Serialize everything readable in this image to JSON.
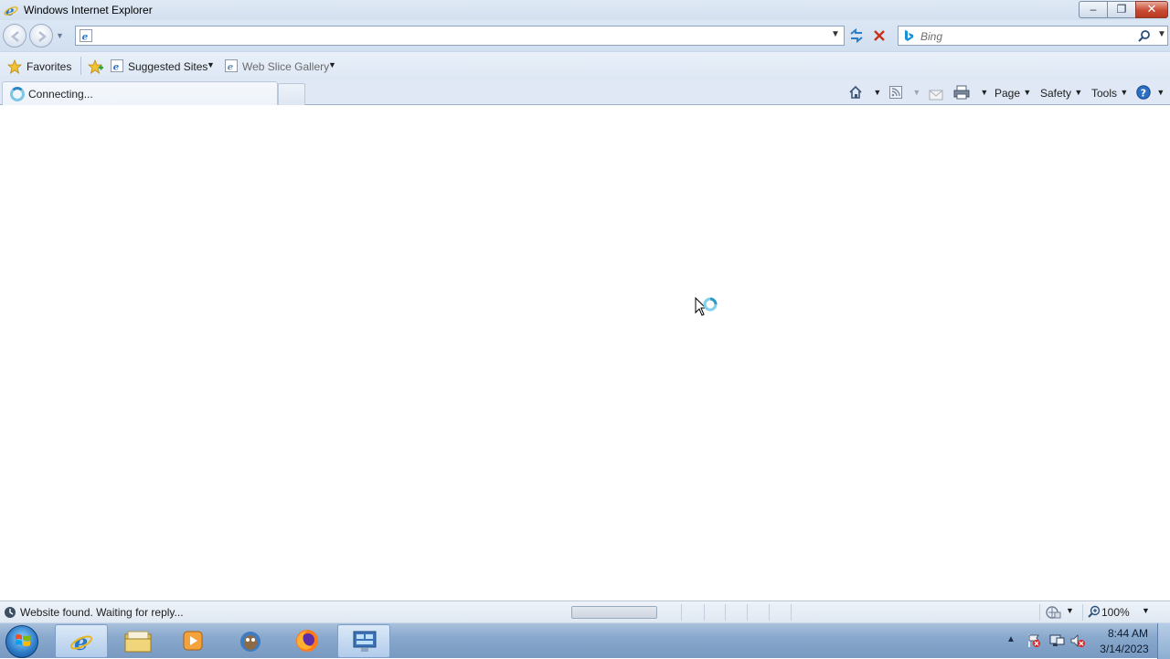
{
  "window": {
    "title": "Windows Internet Explorer",
    "min_glyph": "–",
    "max_glyph": "❐",
    "close_glyph": "✕"
  },
  "navigation": {
    "address_value": "",
    "search_placeholder": "Bing"
  },
  "favorites_bar": {
    "favorites_label": "Favorites",
    "suggested_sites_label": "Suggested Sites",
    "web_slice_gallery_label": "Web Slice Gallery"
  },
  "tabs": [
    {
      "title": "Connecting...",
      "active": true
    }
  ],
  "command_bar": {
    "page_label": "Page",
    "safety_label": "Safety",
    "tools_label": "Tools"
  },
  "status_bar": {
    "text": "Website found. Waiting for reply...",
    "zoom": "100%"
  },
  "taskbar": {
    "time": "8:44 AM",
    "date": "3/14/2023"
  },
  "colors": {
    "accent": "#2a86c2",
    "close_button": "#c94a33"
  },
  "icons": [
    "ie-icon",
    "back-icon",
    "forward-icon",
    "refresh-icon",
    "stop-icon",
    "bing-icon",
    "search-icon",
    "star-icon",
    "add-favorite-icon",
    "home-icon",
    "feeds-icon",
    "mail-icon",
    "print-icon",
    "help-icon",
    "loading-icon",
    "zone-icon",
    "zoom-icon",
    "start-orb-icon",
    "explorer-icon",
    "media-player-icon",
    "gimp-icon",
    "firefox-icon",
    "remote-desktop-icon",
    "flag-icon",
    "network-icon",
    "volume-icon"
  ]
}
